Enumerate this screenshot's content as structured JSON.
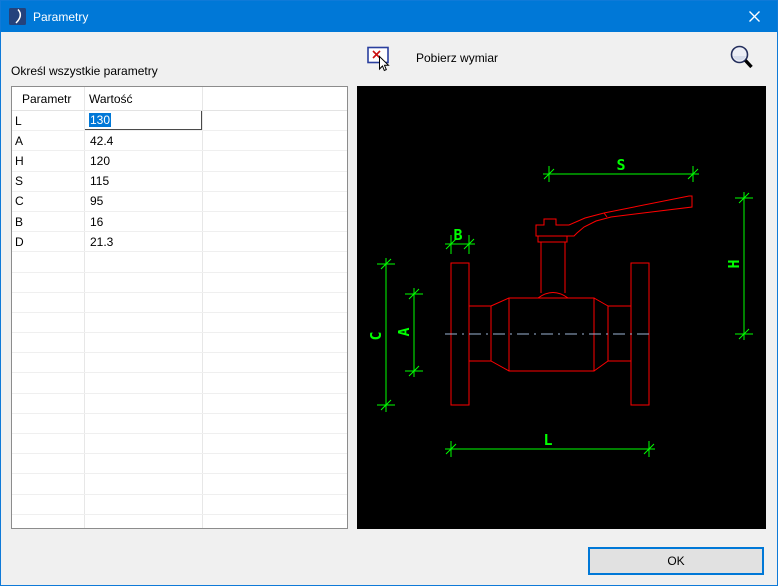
{
  "window": {
    "title": "Parametry"
  },
  "icons": {
    "titlebar": "app-arc-icon",
    "pick": "pick-dimension-icon",
    "zoom": "magnifier-icon",
    "close": "close-icon"
  },
  "toolbar": {
    "pick_dimension_label": "Pobierz wymiar"
  },
  "params_section": {
    "label": "Określ wszystkie parametry"
  },
  "table": {
    "headers": [
      "Parametr",
      "Wartość"
    ],
    "rows": [
      {
        "param": "L",
        "value": "130",
        "editing": true
      },
      {
        "param": "A",
        "value": "42.4"
      },
      {
        "param": "H",
        "value": "120"
      },
      {
        "param": "S",
        "value": "115"
      },
      {
        "param": "C",
        "value": "95"
      },
      {
        "param": "B",
        "value": "16"
      },
      {
        "param": "D",
        "value": "21.3"
      }
    ],
    "empty_rows": 14
  },
  "drawing": {
    "type": "cad-preview",
    "object": "ball-valve-with-lever-side-view",
    "dim_labels": {
      "S": "S",
      "H": "H",
      "B": "B",
      "C": "C",
      "A": "A",
      "L": "L"
    },
    "colors": {
      "background": "#000000",
      "outline": "#ff0000",
      "dimensions": "#00ff00",
      "centerline": "#9cb4d4"
    }
  },
  "footer": {
    "ok_label": "OK"
  },
  "colors": {
    "titlebar": "#0078d7",
    "selection": "#0078d7",
    "client_bg": "#f0f0f0",
    "button_bg": "#e1e1e1"
  }
}
